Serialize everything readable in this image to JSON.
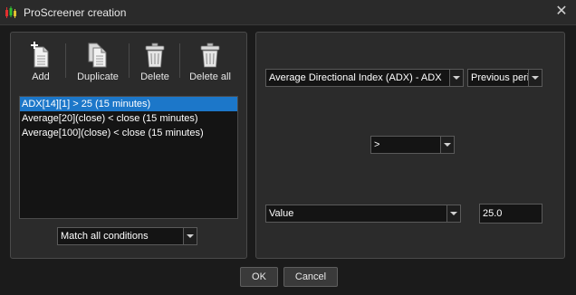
{
  "window": {
    "title": "ProScreener creation",
    "close_icon": "close-icon",
    "app_icon": "candlestick-chart-icon"
  },
  "toolbar": {
    "add_label": "Add",
    "duplicate_label": "Duplicate",
    "delete_label": "Delete",
    "delete_all_label": "Delete all"
  },
  "conditions": [
    "ADX[14][1] > 25 (15 minutes)",
    "Average[20](close) < close (15 minutes)",
    "Average[100](close) < close (15 minutes)"
  ],
  "selected_condition_index": 0,
  "match_mode": {
    "selected": "Match all conditions"
  },
  "editor": {
    "indicator": "Average Directional Index (ADX) - ADX",
    "period": "Previous period",
    "operator": ">",
    "compare_type": "Value",
    "value": "25.0"
  },
  "actions": {
    "ok_label": "OK",
    "cancel_label": "Cancel"
  },
  "colors": {
    "selection": "#1c77c9",
    "background": "#1b1b1b",
    "panel": "#2b2b2b"
  }
}
